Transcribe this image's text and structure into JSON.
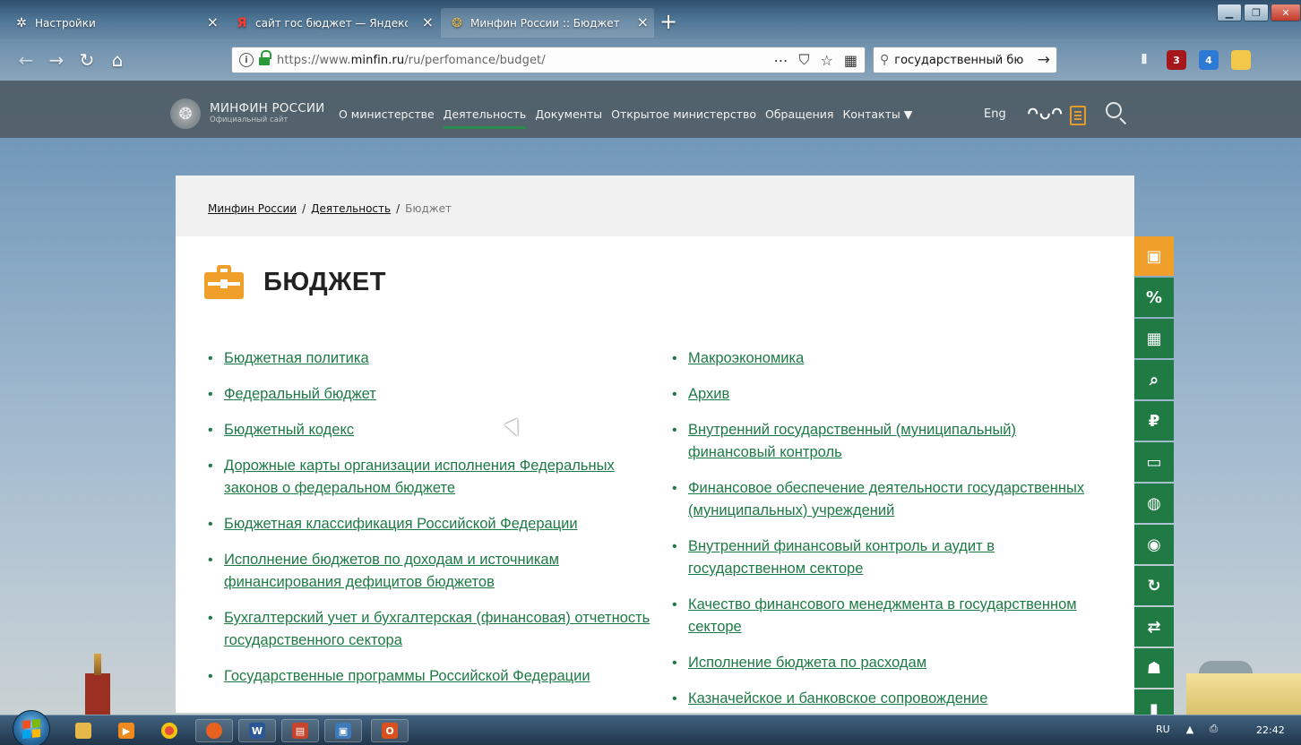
{
  "browser": {
    "tabs": [
      {
        "title": "Настройки",
        "icon": "gear-icon"
      },
      {
        "title": "сайт гос бюджет — Яндекс: н",
        "icon": "yandex-icon"
      },
      {
        "title": "Минфин России :: Бюджет",
        "icon": "emblem-icon"
      }
    ],
    "url_prefix": "https://www.",
    "url_domain": "minfin.ru",
    "url_path": "/ru/perfomance/budget/",
    "search_text": "государственный бю"
  },
  "site": {
    "logo_title": "МИНФИН РОССИИ",
    "logo_subtitle": "Официальный сайт",
    "menu": [
      "О министерстве",
      "Деятельность",
      "Документы",
      "Открытое министерство",
      "Обращения",
      "Контакты ▼"
    ],
    "lang": "Eng"
  },
  "breadcrumb": {
    "home": "Минфин России",
    "section": "Деятельность",
    "current": "Бюджет",
    "separator": "/"
  },
  "page": {
    "title": "БЮДЖЕТ"
  },
  "links_left": [
    "Бюджетная политика",
    "Федеральный бюджет",
    "Бюджетный кодекс",
    "Дорожные карты организации исполнения Федеральных законов о федеральном бюджете",
    "Бюджетная классификация Российской Федерации",
    "Исполнение бюджетов по доходам и источникам финансирования дефицитов бюджетов",
    "Бухгалтерский учет и бухгалтерская (финансовая) отчетность государственного сектора",
    "Государственные программы Российской Федерации"
  ],
  "links_right": [
    "Макроэкономика",
    "Архив",
    "Внутренний государственный (муниципальный) финансовый контроль",
    "Финансовое обеспечение деятельности государственных (муниципальных) учреждений",
    "Внутренний финансовый контроль и аудит в государственном секторе",
    "Качество финансового менеджмента в государственном секторе",
    "Исполнение бюджета по расходам",
    "Казначейское и банковское сопровождение"
  ],
  "taskbar": {
    "lang": "RU",
    "time": "22:42"
  },
  "colors": {
    "accent_green": "#1e7a45",
    "accent_orange": "#f0a02a"
  }
}
